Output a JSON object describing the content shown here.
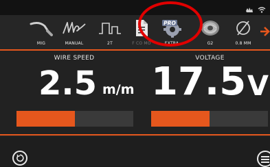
{
  "status": {
    "icons": [
      "hand-icon",
      "wifi-icon"
    ]
  },
  "topnav": {
    "items": [
      {
        "name": "nav-mig",
        "label": "MIG",
        "icon": "torch-icon",
        "dim": false
      },
      {
        "name": "nav-manual",
        "label": "MANUAL",
        "icon": "manual-signature-icon",
        "dim": false
      },
      {
        "name": "nav-2t",
        "label": "2T",
        "icon": "trigger-pulse-icon",
        "dim": false
      },
      {
        "name": "nav-program",
        "label": "F CO MO",
        "icon": "document-icon",
        "dim": true
      },
      {
        "name": "nav-extra",
        "label": "EXTRA",
        "icon": "pro-gear-icon",
        "dim": false
      },
      {
        "name": "nav-g2",
        "label": "G2",
        "icon": "wire-spool-icon",
        "dim": false
      },
      {
        "name": "nav-diameter",
        "label": "0.8 MM",
        "icon": "diameter-icon",
        "dim": false
      }
    ],
    "arrow_icon": "arrow-right-icon",
    "pro_badge": "PRO"
  },
  "wire_speed": {
    "title": "WIRE SPEED",
    "value": "2.5",
    "unit": "m/m",
    "level": 0.5
  },
  "voltage": {
    "title": "VOLTAGE",
    "value": "17.5",
    "unit": "V",
    "level": 0.5
  },
  "bottom": {
    "left_icon": "reset-icon",
    "right_icon": "menu-icon"
  },
  "colors": {
    "accent": "#e6571d",
    "background": "#222222",
    "highlight_circle": "#e00000"
  }
}
